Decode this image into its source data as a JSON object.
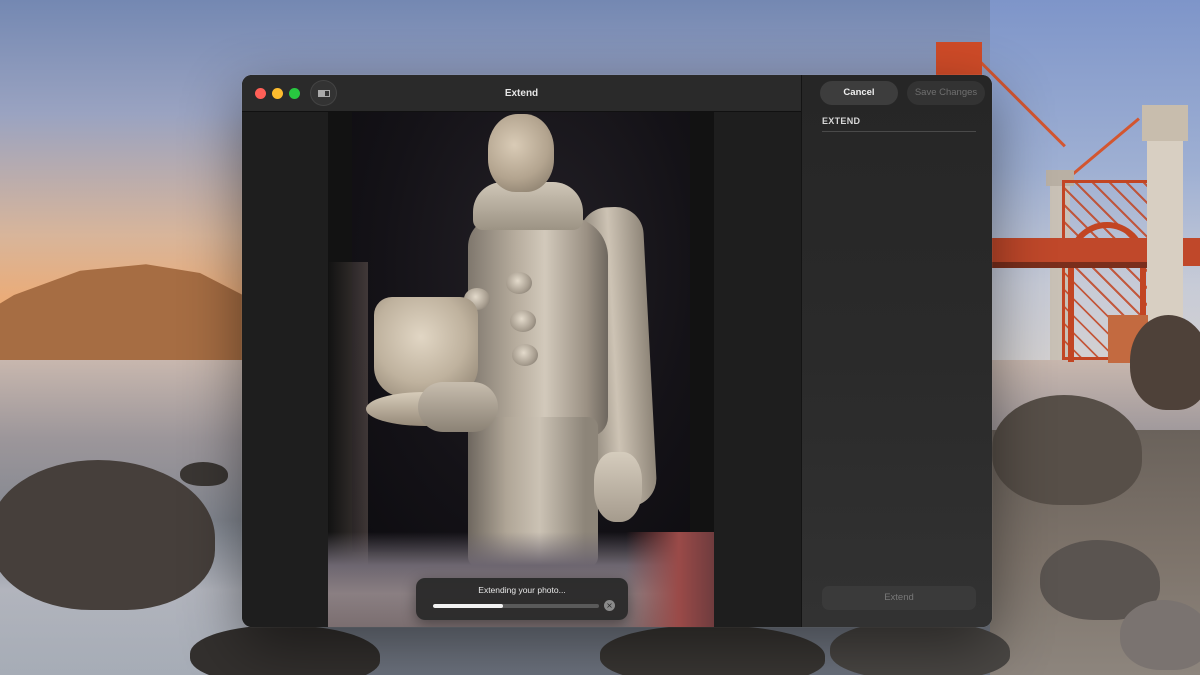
{
  "window": {
    "title": "Extend"
  },
  "sidebar": {
    "cancel_label": "Cancel",
    "save_label": "Save Changes",
    "section_title": "EXTEND",
    "extend_label": "Extend"
  },
  "progress": {
    "label": "Extending your photo...",
    "fraction": 0.42,
    "cancel_icon": "x-circle-icon"
  },
  "colors": {
    "close": "#ff5f57",
    "minimize": "#febc2e",
    "maximize": "#28c840",
    "window_bg": "#1e1e1e",
    "sidebar_bg": "#2a2a2a"
  }
}
